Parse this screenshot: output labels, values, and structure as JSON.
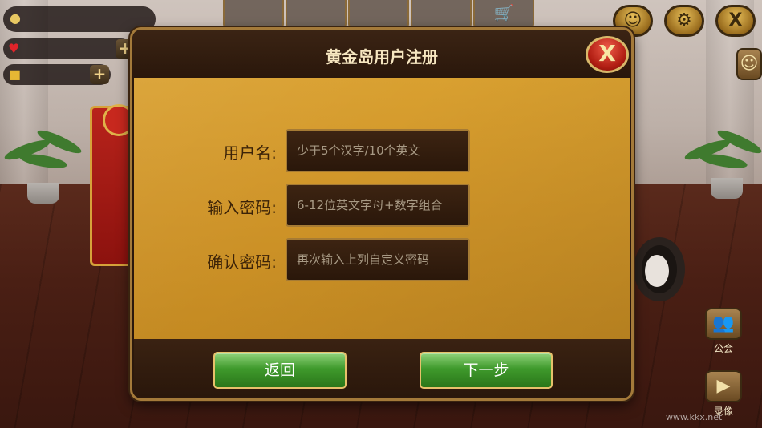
{
  "dialog": {
    "title": "黄金岛用户注册",
    "close_label": "X"
  },
  "form": {
    "username_label": "用户名:",
    "username_placeholder": "少于5个汉字/10个英文",
    "password_label": "输入密码:",
    "password_placeholder": "6-12位英文字母+数字组合",
    "confirm_label": "确认密码:",
    "confirm_placeholder": "再次输入上列自定义密码"
  },
  "buttons": {
    "back_label": "返回",
    "next_label": "下一步"
  },
  "top_right": {
    "settings_icon": "⚙",
    "close_label": "X"
  },
  "side_buttons": {
    "guild_label": "公会",
    "record_label": "录像"
  },
  "watermark": "www.kkx.net",
  "colors": {
    "dialog_gold": "#d9a030",
    "dialog_dark": "#2b180c",
    "button_green": "#3f9a2c",
    "close_red": "#b01d12"
  }
}
